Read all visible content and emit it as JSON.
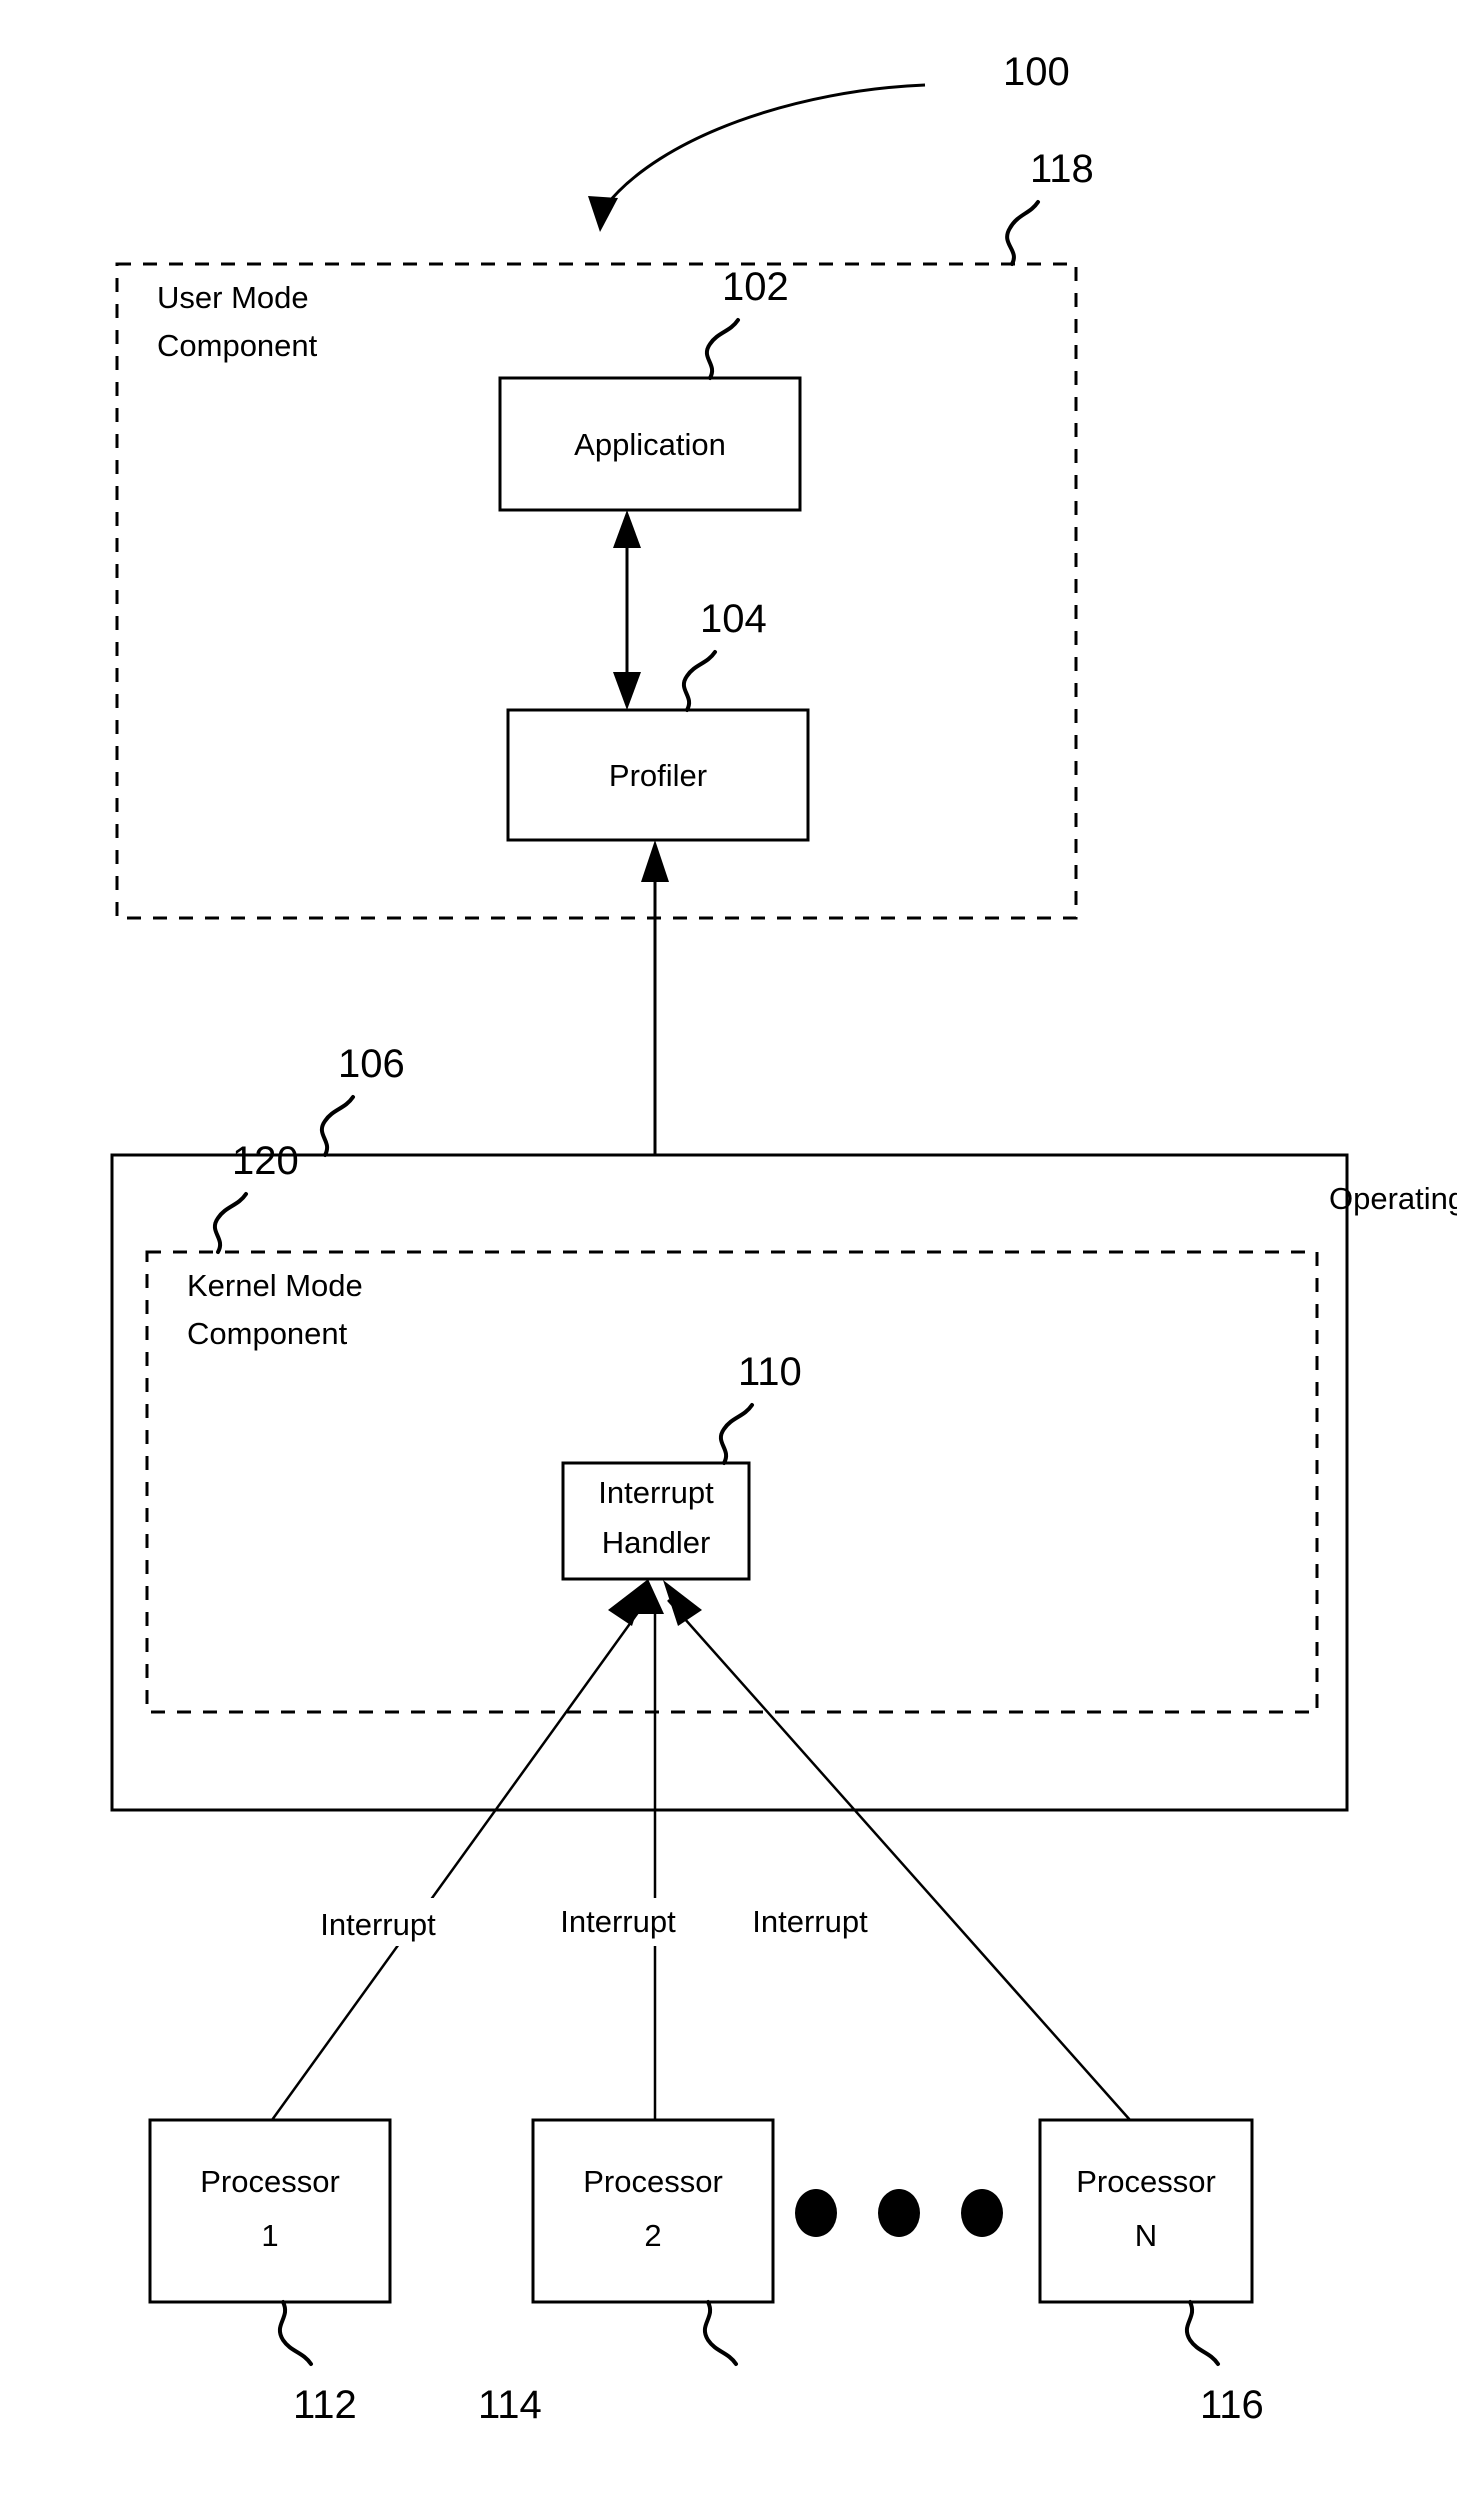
{
  "figure": {
    "title_ref": "100",
    "type": "patent-block-diagram"
  },
  "callouts": {
    "system": "100",
    "user_mode_component": "118",
    "application": "102",
    "profiler": "104",
    "operating_system": "106",
    "kernel_mode_component": "120",
    "interrupt_handler": "110",
    "processor_1": "112",
    "processor_2": "114",
    "processor_n": "116"
  },
  "regions": {
    "user_mode": {
      "label_line1": "User Mode",
      "label_line2": "Component"
    },
    "operating_system": {
      "label": "Operating System"
    },
    "kernel_mode": {
      "label_line1": "Kernel Mode",
      "label_line2": "Component"
    }
  },
  "blocks": {
    "application": {
      "label": "Application"
    },
    "profiler": {
      "label": "Profiler"
    },
    "interrupt_handler": {
      "label_line1": "Interrupt",
      "label_line2": "Handler"
    },
    "processor_1": {
      "label_line1": "Processor",
      "label_line2": "1"
    },
    "processor_2": {
      "label_line1": "Processor",
      "label_line2": "2"
    },
    "processor_n": {
      "label_line1": "Processor",
      "label_line2": "N"
    }
  },
  "edges": {
    "interrupt_1": "Interrupt",
    "interrupt_2": "Interrupt",
    "interrupt_3": "Interrupt"
  },
  "colors": {
    "stroke": "#000000",
    "background": "#ffffff"
  }
}
